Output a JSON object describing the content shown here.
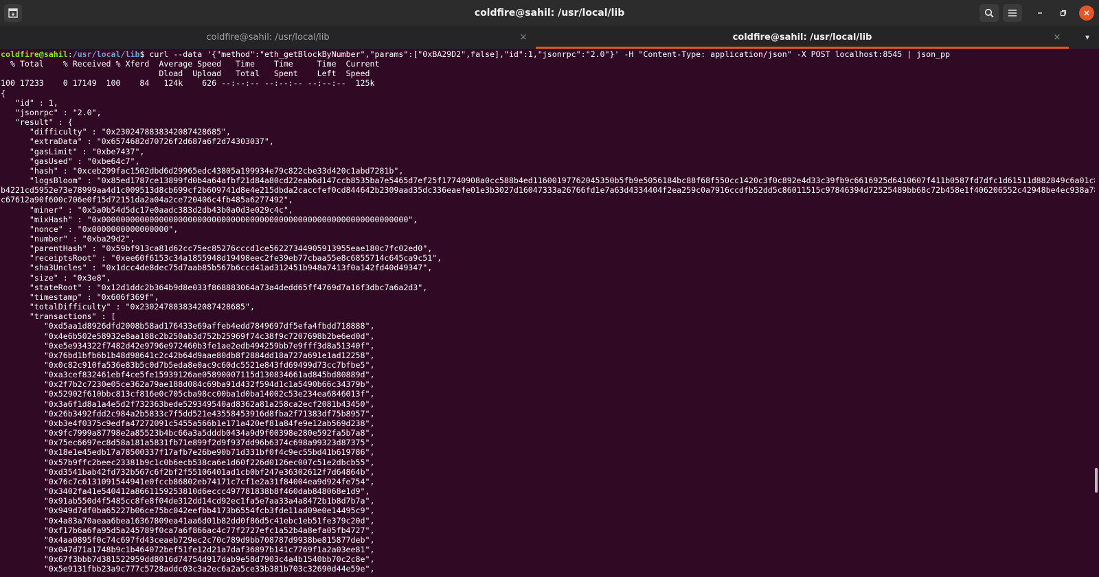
{
  "window": {
    "title": "coldfire@sahil: /usr/local/lib",
    "icons": {
      "new_tab": "new-tab-icon",
      "search": "search-icon",
      "menu": "hamburger-menu-icon",
      "minimize": "minimize-icon",
      "maximize": "restore-icon",
      "close": "close-icon"
    }
  },
  "tabs": [
    {
      "label": "coldfire@sahil: /usr/local/lib",
      "active": false,
      "close": "×"
    },
    {
      "label": "coldfire@sahil: /usr/local/lib",
      "active": true,
      "close": "×"
    }
  ],
  "tab_overflow": "▾",
  "colors": {
    "terminal_bg": "#300a24",
    "prompt_user": "#8ae234",
    "prompt_path": "#729fcf",
    "tab_accent": "#e95420",
    "close_button": "#e95420"
  },
  "terminal": {
    "prompt": {
      "user_host": "coldfire@sahil",
      "separator": ":",
      "path": "/usr/local/lib",
      "symbol": "$ "
    },
    "command": "curl --data '{\"method\":\"eth_getBlockByNumber\",\"params\":[\"0xBA29D2\",false],\"id\":1,\"jsonrpc\":\"2.0\"}' -H \"Content-Type: application/json\" -X POST localhost:8545 | json_pp",
    "output": [
      "  % Total    % Received % Xferd  Average Speed   Time    Time     Time  Current",
      "                                 Dload  Upload   Total   Spent    Left  Speed",
      "100 17233    0 17149  100    84   124k    626 --:--:-- --:--:-- --:--:--  125k",
      "{",
      "   \"id\" : 1,",
      "   \"jsonrpc\" : \"2.0\",",
      "   \"result\" : {",
      "      \"difficulty\" : \"0x230247883834208742868​5\",",
      "      \"extraData\" : \"0x6574682d70726f2d687a6f2d74303037\",",
      "      \"gasLimit\" : \"0xbe7437\",",
      "      \"gasUsed\" : \"0xbe64c7\",",
      "      \"hash\" : \"0xceb299fac1502dbd6d29965edc43805a199934e79c822cbe33d420c1abd7281b\",",
      "      \"logsBloom\" : \"0x85ed1787ce13899fd0b4a64afbf21d84a80cd22eab6d147ccb8535ba7e5465d7ef25f17740908a0cc588b4ed11600197762045350b5fb9e5056184bc88f68f550cc1420c3f0c892e4d33c39fb9c6616925d6410607f411b0587fd7dfc1d61511d882849c6a01c8d2260c519",
      "b4221cd5952e73e78999aa4d1c009513d8cb699cf2b609741d8e4e215dbda2caccfef0cd844642b2309aad35dc336eaefe01e3b3027d16047333a26766fd1e7a63d4334404f2ea259c0a7916ccdfb52dd5c86011515c97846394d72525489bb68c72b458e1f406206552c42948be4ec938a78e57695b63",
      "c67612a90f600c706e0f15d72151da2a04a2ce720406c4fb485a6277492\",",
      "      \"miner\" : \"0x5a0b54d5dc17e0aadc383d2db43b0a0d3e029c4c\",",
      "      \"mixHash\" : \"0x0000000000000000000000000000000000000000000000000000000000000000\",",
      "      \"nonce\" : \"0x0000000000000000\",",
      "      \"number\" : \"0xba29d2\",",
      "      \"parentHash\" : \"0x59bf913ca81d62cc75ec85276cccd1ce56227344905913955eae180c7fc02ed0\",",
      "      \"receiptsRoot\" : \"0xee60f6153c34a1855948d19498eec2fe39eb77cbaa55e8c6855714c645ca9c51\",",
      "      \"sha3Uncles\" : \"0x1dcc4de8dec75d7aab85b567b6ccd41ad312451b948a7413f0a142fd40d49347\",",
      "      \"size\" : \"0x3e8\",",
      "      \"stateRoot\" : \"0x12d1ddc2b364b9d8e033f868883064a73a4dedd65ff4769d7a16f3dbc7a6a2d3\",",
      "      \"timestamp\" : \"0x606f369f\",",
      "      \"totalDifficulty\" : \"0x230247883834208742868​5\",",
      "      \"transactions\" : [",
      "         \"0xd5aa1d8926dfd2008b58ad176433e69affeb4edd7849697df5efa4fbdd718888\",",
      "         \"0x4e6b502e58932e8aa188c2b250ab3d752b25969f74c38f9c7207698b2be6ed0d\",",
      "         \"0xe5e934322f7482d42e9796e972460b3fe1ae2edb494259bb7e9fff3d8a51340f\",",
      "         \"0x76bd1bfb6b1b48d98641c2c42b64d9aae80db8f2884dd18a727a691e1ad12258\",",
      "         \"0x0c82c910fa536e83b5c0d7b5eda8e0ac9c60dc5521e843fd69499d73cc7bfbe5\",",
      "         \"0xa3cef832461ebf4ce5fe15939126ae05890007115d130834661ad845bd80889d\",",
      "         \"0x2f7b2c7230e05ce362a79ae188d084c69ba91d432f594d1c1a5490b66c34379b\",",
      "         \"0x52902f610bbc813cf816e0c705cba98cc00ba1d0ba14002c53e234ea6846013f\",",
      "         \"0x3a6f1d8a1a4e5d2f732363bede529349540ad8362a81a258ca2ecf2081b43450\",",
      "         \"0x26b3492fdd2c984a2b5833c7f5dd521e43558453916d8fba2f71383df75b8957\",",
      "         \"0xb3e4f0375c9edfa47272091c5455a566b1e171a420ef81a84fe9e12ab569d238\",",
      "         \"0x9fc7999a87798e2a85523b4bc66a3a5dddb0434a9d9f00398e280e592fa5b7a8\",",
      "         \"0x75ec6697ec8d58a181a5831fb71e899f2d9f937dd96b6374c698a99323d87375\",",
      "         \"0x18e1e45edb17a78500337f17afb7e26be90b71d331bf0f4c9ec55bd41b619786\",",
      "         \"0x57b9ffc2beec23381b9c1c0b6ecb538ca6e1d60f226d0126ec007c51e2dbcb55\",",
      "         \"0xd3541bab42fd732b567c6f2bf2f55106401ad1cb0bf247e36302612f7d64864b\",",
      "         \"0x76c7c6131091544941e0fccb86802eb74171c7cf1e2a31f84004ea9d924fe754\",",
      "         \"0x3402fa41e540412a8661159253810d6eccc497781838b8f460dab848068e1d9\",",
      "         \"0x91ab550d4f5485cc8fe8f04de312dd14cd92ec1fa5e7aa33a4a8472b1b8d7b7a\",",
      "         \"0x949d7df0ba65227b06ce75bc042eefbb4173b6554fcb3fde11ad09e0e14495c9\",",
      "         \"0x4a83a70aeaa6bea16367809ea41aa6d01b82dd0f86d5c41ebc1eb51fe379c20d\",",
      "         \"0xf17b6a6fa95d5a245789f0ca7a6f866ac4c77f2727efc1a52b4a8efa05fb4727\",",
      "         \"0x4aa0895f0c74c697fd43ceaeb729ec2c70c789d9bb708787d9938be815877deb\",",
      "         \"0x047d71a1748b9c1b464072bef51fe12d21a7daf36897b141c7769f1a2a03ee81\",",
      "         \"0x67f3bbb7d381522959dd8016d74754d917dab9e58d7903c4a4b1540bb70c2c8e\",",
      "         \"0x5e9131fbb23a9c777c5728addc03c3a2ec6a2a5ce33b381b703c32690d44e59e\","
    ]
  }
}
